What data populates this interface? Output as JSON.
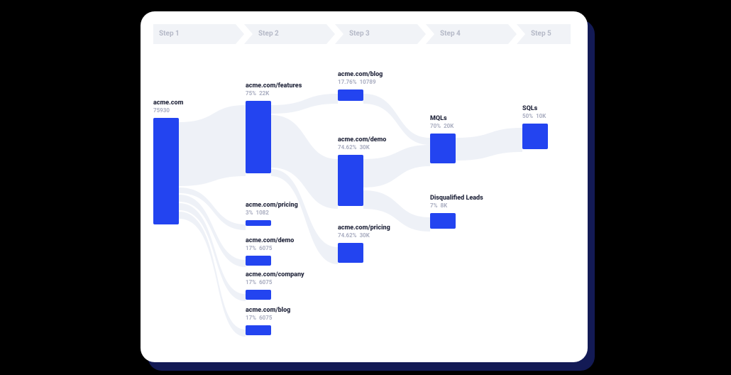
{
  "steps": [
    "Step 1",
    "Step 2",
    "Step 3",
    "Step 4",
    "Step 5"
  ],
  "nodes": {
    "s1_root": {
      "title": "acme.com",
      "pct": "",
      "count": "75930"
    },
    "s2_features": {
      "title": "acme.com/features",
      "pct": "75%",
      "count": "22K"
    },
    "s2_pricing": {
      "title": "acme.com/pricing",
      "pct": "3%",
      "count": "1082"
    },
    "s2_demo": {
      "title": "acme.com/demo",
      "pct": "17%",
      "count": "6075"
    },
    "s2_company": {
      "title": "acme.com/company",
      "pct": "17%",
      "count": "6075"
    },
    "s2_blog": {
      "title": "acme.com/blog",
      "pct": "17%",
      "count": "6075"
    },
    "s3_blog": {
      "title": "acme.com/blog",
      "pct": "17.76%",
      "count": "10789"
    },
    "s3_demo": {
      "title": "acme.com/demo",
      "pct": "74.62%",
      "count": "30K"
    },
    "s3_pricing": {
      "title": "acme.com/pricing",
      "pct": "74.62%",
      "count": "30K"
    },
    "s4_mqls": {
      "title": "MQLs",
      "pct": "70%",
      "count": "20K"
    },
    "s4_disq": {
      "title": "Disqualified Leads",
      "pct": "7%",
      "count": "8K"
    },
    "s5_sqls": {
      "title": "SQLs",
      "pct": "50%",
      "count": "10K"
    }
  },
  "chart_data": {
    "type": "sankey",
    "title": "",
    "steps": [
      "Step 1",
      "Step 2",
      "Step 3",
      "Step 4",
      "Step 5"
    ],
    "nodes": [
      {
        "id": "s1_root",
        "step": 1,
        "label": "acme.com",
        "value": 75930,
        "percent": null
      },
      {
        "id": "s2_features",
        "step": 2,
        "label": "acme.com/features",
        "value": 22000,
        "percent": 75
      },
      {
        "id": "s2_pricing",
        "step": 2,
        "label": "acme.com/pricing",
        "value": 1082,
        "percent": 3
      },
      {
        "id": "s2_demo",
        "step": 2,
        "label": "acme.com/demo",
        "value": 6075,
        "percent": 17
      },
      {
        "id": "s2_company",
        "step": 2,
        "label": "acme.com/company",
        "value": 6075,
        "percent": 17
      },
      {
        "id": "s2_blog",
        "step": 2,
        "label": "acme.com/blog",
        "value": 6075,
        "percent": 17
      },
      {
        "id": "s3_blog",
        "step": 3,
        "label": "acme.com/blog",
        "value": 10789,
        "percent": 17.76
      },
      {
        "id": "s3_demo",
        "step": 3,
        "label": "acme.com/demo",
        "value": 30000,
        "percent": 74.62
      },
      {
        "id": "s3_pricing",
        "step": 3,
        "label": "acme.com/pricing",
        "value": 30000,
        "percent": 74.62
      },
      {
        "id": "s4_mqls",
        "step": 4,
        "label": "MQLs",
        "value": 20000,
        "percent": 70
      },
      {
        "id": "s4_disq",
        "step": 4,
        "label": "Disqualified Leads",
        "value": 8000,
        "percent": 7
      },
      {
        "id": "s5_sqls",
        "step": 5,
        "label": "SQLs",
        "value": 10000,
        "percent": 50
      }
    ],
    "links": [
      {
        "source": "s1_root",
        "target": "s2_features"
      },
      {
        "source": "s1_root",
        "target": "s2_pricing"
      },
      {
        "source": "s1_root",
        "target": "s2_demo"
      },
      {
        "source": "s1_root",
        "target": "s2_company"
      },
      {
        "source": "s1_root",
        "target": "s2_blog"
      },
      {
        "source": "s2_features",
        "target": "s3_blog"
      },
      {
        "source": "s2_features",
        "target": "s3_demo"
      },
      {
        "source": "s2_features",
        "target": "s3_pricing"
      },
      {
        "source": "s3_blog",
        "target": "s4_mqls"
      },
      {
        "source": "s3_demo",
        "target": "s4_mqls"
      },
      {
        "source": "s3_demo",
        "target": "s4_disq"
      },
      {
        "source": "s4_mqls",
        "target": "s5_sqls"
      }
    ]
  }
}
